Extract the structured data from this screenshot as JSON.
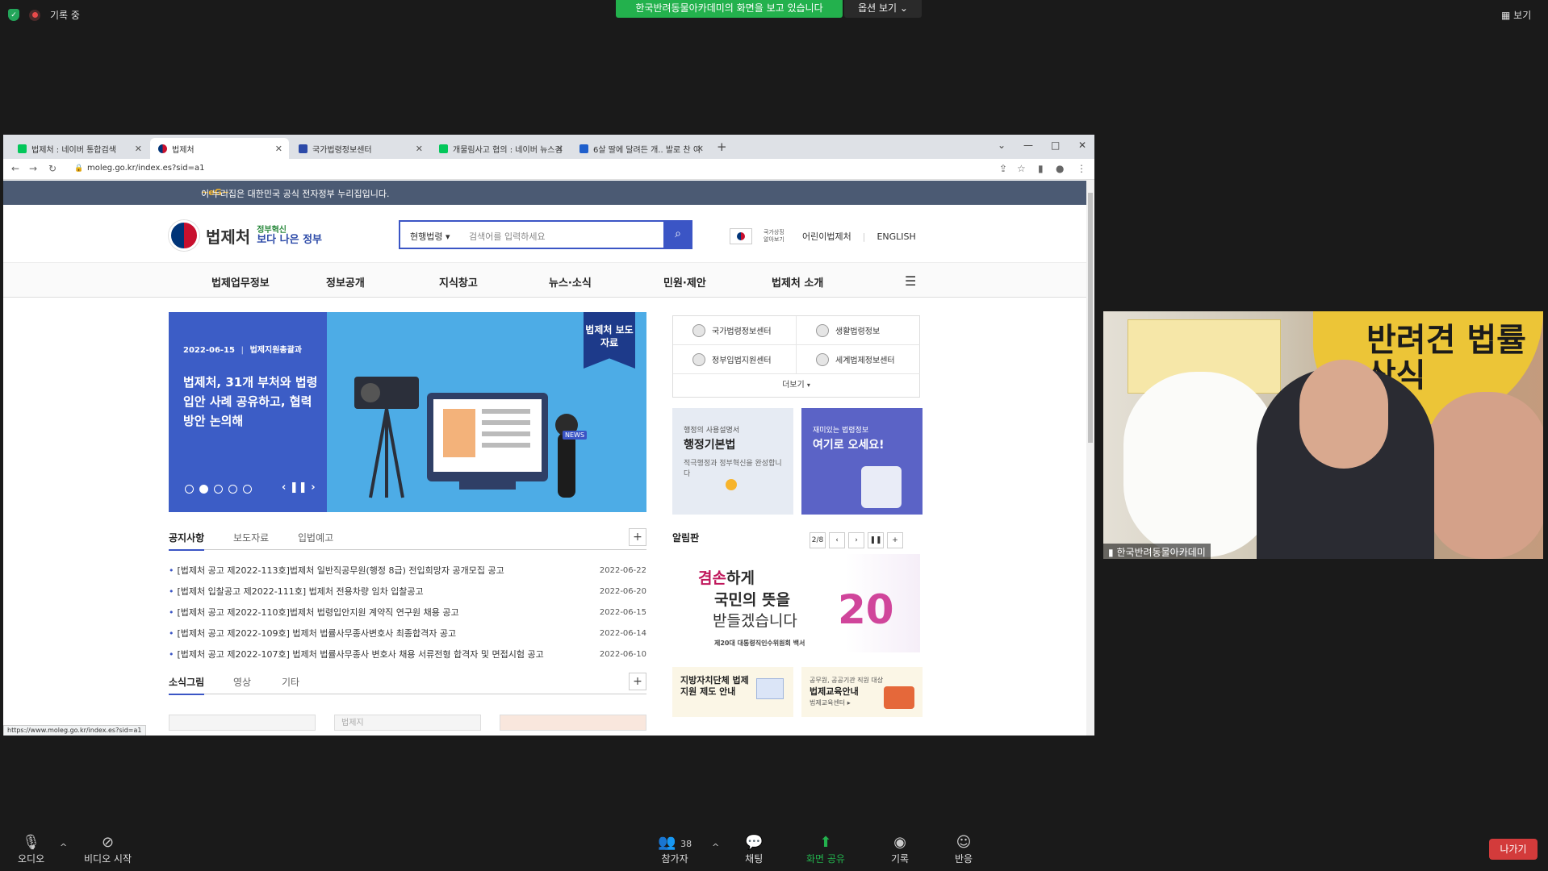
{
  "zoom": {
    "recording_label": "기록 중",
    "share_banner": "한국반려동물아카데미의 화면을 보고 있습니다",
    "view_options": "옵션 보기",
    "view_button": "보기",
    "participant_count": "38",
    "bottom": {
      "audio": "오디오",
      "video": "비디오 시작",
      "participants": "참가자",
      "chat": "채팅",
      "share": "화면 공유",
      "record": "기록",
      "reactions": "반응",
      "leave": "나가기"
    },
    "video_label": "한국반려동물아카데미",
    "video_overlay_title": "반려견 법률 상식"
  },
  "browser": {
    "tabs": [
      {
        "label": "법제처 : 네이버 통합검색",
        "color": "#03c75a"
      },
      {
        "label": "법제처",
        "color": "#003478"
      },
      {
        "label": "국가법령정보센터",
        "color": "#2c4aa8"
      },
      {
        "label": "개물림사고 협의 : 네이버 뉴스검",
        "color": "#03c75a"
      },
      {
        "label": "6살 딸에 달려든 개.. 발로 찬 이",
        "color": "#1f5fcc"
      }
    ],
    "url": "moleg.go.kr/index.es?sid=a1",
    "status_url": "https://www.moleg.go.kr/index.es?sid=a1"
  },
  "page": {
    "gov_strip": "이 누리집은 대한민국 공식 전자정부 누리집입니다.",
    "logo_text": "법제처",
    "logo_sub_top": "정부혁신",
    "logo_sub_main": "보다 나은 정부",
    "search_select": "현행법령",
    "search_placeholder": "검색어를 입력하세요",
    "header_links": {
      "flag_caption": "국가상징 알아보기",
      "kids": "어린이법제처",
      "english": "ENGLISH"
    },
    "gnb": [
      "법제업무정보",
      "정보공개",
      "지식창고",
      "뉴스·소식",
      "민원·제안",
      "법제처 소개"
    ],
    "banner": {
      "date": "2022-06-15",
      "dept": "법제지원총괄과",
      "title": "법제처, 31개 부처와 법령입안 사례 공유하고, 협력방안 논의해",
      "ribbon": "법제처 보도자료",
      "news_tag": "NEWS"
    },
    "quick_links": [
      "국가법령정보센터",
      "생활법령정보",
      "정부입법지원센터",
      "세계법제정보센터"
    ],
    "more_label": "더보기",
    "card1": {
      "sub": "행정의 사용설명서",
      "title": "행정기본법",
      "desc": "적극행정과 정부혁신을 완성합니다"
    },
    "card2": {
      "sub": "재미있는 법령정보",
      "title": "여기로 오세요!"
    },
    "notice_tabs": [
      "공지사항",
      "보도자료",
      "입법예고"
    ],
    "notices": [
      {
        "title": "[법제처 공고 제2022-113호]법제처 일반직공무원(행정 8급) 전입희망자 공개모집 공고",
        "date": "2022-06-22"
      },
      {
        "title": "[법제처 입찰공고 제2022-111호] 법제처 전용차량 임차 입찰공고",
        "date": "2022-06-20"
      },
      {
        "title": "[법제처 공고 제2022-110호]법제처 법령입안지원 계약직 연구원 채용 공고",
        "date": "2022-06-15"
      },
      {
        "title": "[법제처 공고 제2022-109호] 법제처 법률사무종사변호사 최종합격자 공고",
        "date": "2022-06-14"
      },
      {
        "title": "[법제처 공고 제2022-107호] 법제처 법률사무종사 변호사 채용 서류전형 합격자 및 면접시험 공고",
        "date": "2022-06-10"
      }
    ],
    "media_tabs": [
      "소식그림",
      "영상",
      "기타"
    ],
    "alim": {
      "title": "알림판",
      "page": "2/8",
      "line1a": "겸손",
      "line1b": "하게",
      "line2": "국민의 뜻을",
      "line3": "받들겠습니다",
      "caption": "제20대 대통령직인수위원회 백서",
      "num": "20"
    },
    "bottom_cards": [
      {
        "sub": "",
        "title": "지방자치단체 법제지원 제도 안내",
        "link": ""
      },
      {
        "sub": "공무원, 공공기관 직원 대상",
        "title": "법제교육안내",
        "link": "법제교육센터 ▸"
      }
    ],
    "thumb_label": "법제지"
  }
}
